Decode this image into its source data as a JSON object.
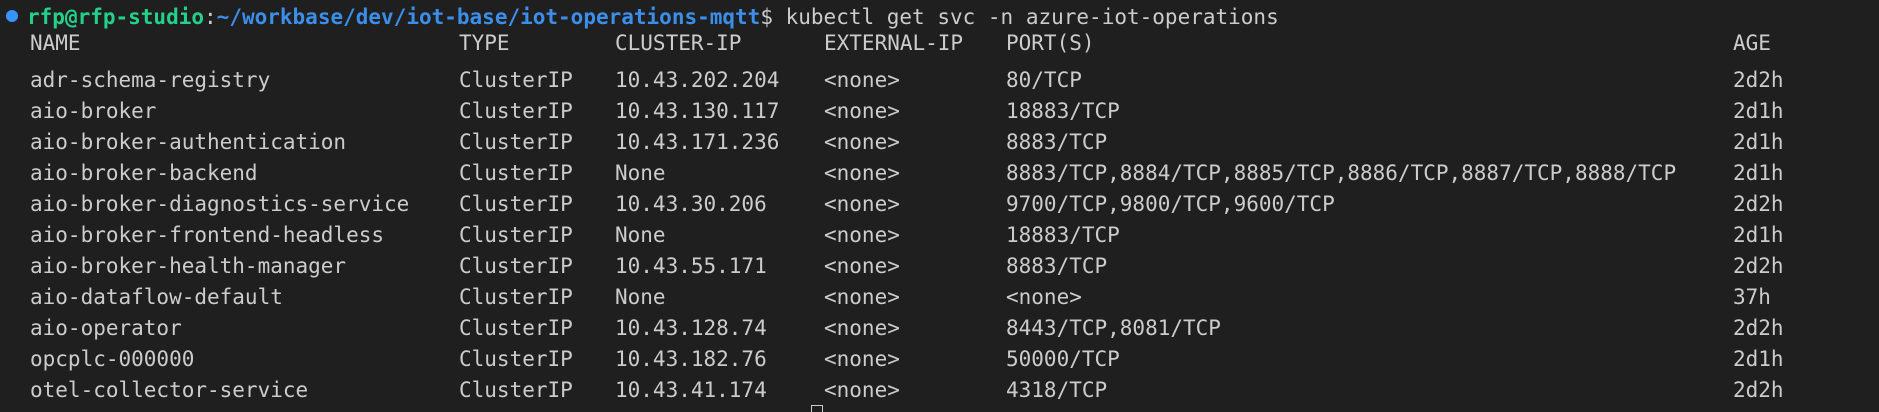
{
  "prompt": {
    "user_host": "rfp@rfp-studio",
    "colon": ":",
    "path": "~/workbase/dev/iot-base/iot-operations-mqtt",
    "dollar": "$",
    "command": " kubectl get svc -n azure-iot-operations"
  },
  "table": {
    "headers": {
      "name": "NAME",
      "type": "TYPE",
      "cluster_ip": "CLUSTER-IP",
      "external_ip": "EXTERNAL-IP",
      "ports": "PORT(S)",
      "age": "AGE"
    },
    "rows": [
      {
        "name": "adr-schema-registry",
        "type": "ClusterIP",
        "cluster_ip": "10.43.202.204",
        "external_ip": "<none>",
        "ports": "80/TCP",
        "age": "2d2h"
      },
      {
        "name": "aio-broker",
        "type": "ClusterIP",
        "cluster_ip": "10.43.130.117",
        "external_ip": "<none>",
        "ports": "18883/TCP",
        "age": "2d1h"
      },
      {
        "name": "aio-broker-authentication",
        "type": "ClusterIP",
        "cluster_ip": "10.43.171.236",
        "external_ip": "<none>",
        "ports": "8883/TCP",
        "age": "2d1h"
      },
      {
        "name": "aio-broker-backend",
        "type": "ClusterIP",
        "cluster_ip": "None",
        "external_ip": "<none>",
        "ports": "8883/TCP,8884/TCP,8885/TCP,8886/TCP,8887/TCP,8888/TCP",
        "age": "2d1h"
      },
      {
        "name": "aio-broker-diagnostics-service",
        "type": "ClusterIP",
        "cluster_ip": "10.43.30.206",
        "external_ip": "<none>",
        "ports": "9700/TCP,9800/TCP,9600/TCP",
        "age": "2d2h"
      },
      {
        "name": "aio-broker-frontend-headless",
        "type": "ClusterIP",
        "cluster_ip": "None",
        "external_ip": "<none>",
        "ports": "18883/TCP",
        "age": "2d1h"
      },
      {
        "name": "aio-broker-health-manager",
        "type": "ClusterIP",
        "cluster_ip": "10.43.55.171",
        "external_ip": "<none>",
        "ports": "8883/TCP",
        "age": "2d2h"
      },
      {
        "name": "aio-dataflow-default",
        "type": "ClusterIP",
        "cluster_ip": "None",
        "external_ip": "<none>",
        "ports": "<none>",
        "age": "37h"
      },
      {
        "name": "aio-operator",
        "type": "ClusterIP",
        "cluster_ip": "10.43.128.74",
        "external_ip": "<none>",
        "ports": "8443/TCP,8081/TCP",
        "age": "2d2h"
      },
      {
        "name": "opcplc-000000",
        "type": "ClusterIP",
        "cluster_ip": "10.43.182.76",
        "external_ip": "<none>",
        "ports": "50000/TCP",
        "age": "2d1h"
      },
      {
        "name": "otel-collector-service",
        "type": "ClusterIP",
        "cluster_ip": "10.43.41.174",
        "external_ip": "<none>",
        "ports": "4318/TCP",
        "age": "2d2h"
      }
    ]
  },
  "colors": {
    "background": "#1f1f1f",
    "text": "#cccccc",
    "user_host": "#23d18b",
    "path": "#3b8eea",
    "decoration": "#3794ff"
  }
}
